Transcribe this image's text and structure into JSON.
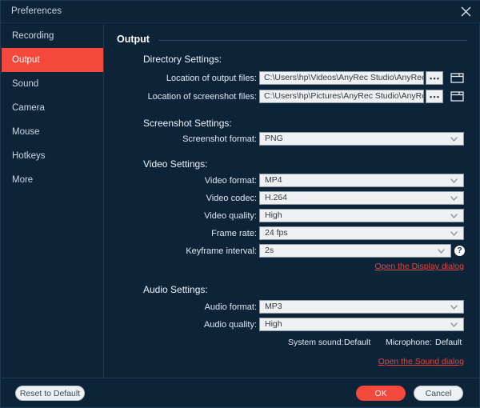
{
  "window": {
    "title": "Preferences",
    "close_icon": "close-icon"
  },
  "accent_color": "#f4483c",
  "background_color": "#0d2338",
  "link_color": "#e8453c",
  "sidebar": {
    "items": [
      {
        "label": "Recording",
        "active": false
      },
      {
        "label": "Output",
        "active": true
      },
      {
        "label": "Sound",
        "active": false
      },
      {
        "label": "Camera",
        "active": false
      },
      {
        "label": "Mouse",
        "active": false
      },
      {
        "label": "Hotkeys",
        "active": false
      },
      {
        "label": "More",
        "active": false
      }
    ]
  },
  "main": {
    "pane_title": "Output",
    "directory": {
      "group_title": "Directory Settings:",
      "output_label": "Location of output files:",
      "output_value": "C:\\Users\\hp\\Videos\\AnyRec Studio\\AnyRec S",
      "screenshot_label": "Location of screenshot files:",
      "screenshot_value": "C:\\Users\\hp\\Pictures\\AnyRec Studio\\AnyRec",
      "browse_dots": "•••",
      "browse_icon": "ellipsis-icon",
      "folder_icon": "folder-icon"
    },
    "screenshot": {
      "group_title": "Screenshot Settings:",
      "format_label": "Screenshot format:",
      "format_value": "PNG"
    },
    "video": {
      "group_title": "Video Settings:",
      "format_label": "Video format:",
      "format_value": "MP4",
      "codec_label": "Video codec:",
      "codec_value": "H.264",
      "quality_label": "Video quality:",
      "quality_value": "High",
      "framerate_label": "Frame rate:",
      "framerate_value": "24 fps",
      "keyframe_label": "Keyframe interval:",
      "keyframe_value": "2s",
      "help_icon": "help-icon",
      "help_glyph": "?",
      "display_link": "Open the Display dialog"
    },
    "audio": {
      "group_title": "Audio Settings:",
      "format_label": "Audio format:",
      "format_value": "MP3",
      "quality_label": "Audio quality:",
      "quality_value": "High",
      "system_sound_label": "System sound:",
      "system_sound_value": "Default",
      "microphone_label": "Microphone:",
      "microphone_value": "Default",
      "sound_link": "Open the Sound dialog"
    }
  },
  "footer": {
    "reset_label": "Reset to Default",
    "ok_label": "OK",
    "cancel_label": "Cancel"
  }
}
